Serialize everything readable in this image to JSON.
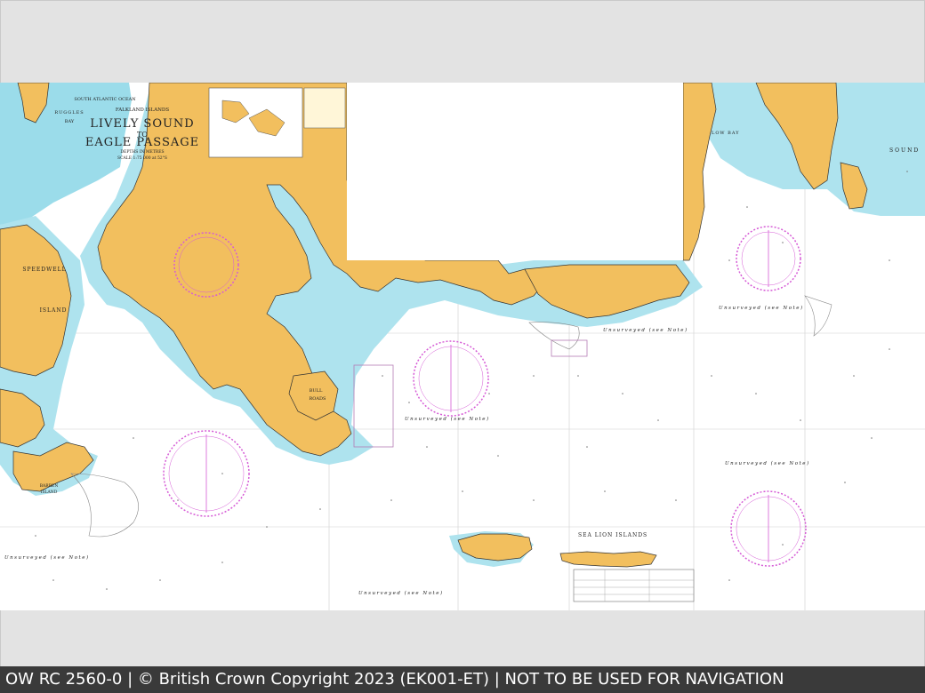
{
  "chart": {
    "title_line1": "LIVELY SOUND",
    "title_line2": "TO",
    "title_line3": "EAGLE PASSAGE",
    "region": "FALKLAND ISLANDS",
    "ocean": "SOUTH ATLANTIC OCEAN",
    "depths": "DEPTHS IN METRES",
    "scale": "SCALE 1:75 000 at 52°S"
  },
  "places": {
    "speedwell": "SPEEDWELL",
    "island": "ISLAND",
    "bull": "BULL",
    "roads": "ROADS",
    "sea_lion_islands": "SEA LION ISLANDS",
    "low_bay": "LOW BAY",
    "ruggles": "RUGGLES",
    "bay": "BAY",
    "sound": "SOUND",
    "barren": "BARREN",
    "barren_island": "ISLAND"
  },
  "notes": {
    "unsurveyed": "Unsurveyed (see Note)"
  },
  "colors": {
    "land": "#f2bf5e",
    "shallow": "#aee3ee",
    "deep_shallow": "#7fd3e6",
    "compass": "#d65bd6",
    "footer_bg": "#3a3a3a"
  },
  "footer": {
    "text": "OW RC 2560-0 | © British Crown Copyright 2023 (EK001-ET) | NOT TO BE USED FOR NAVIGATION"
  }
}
